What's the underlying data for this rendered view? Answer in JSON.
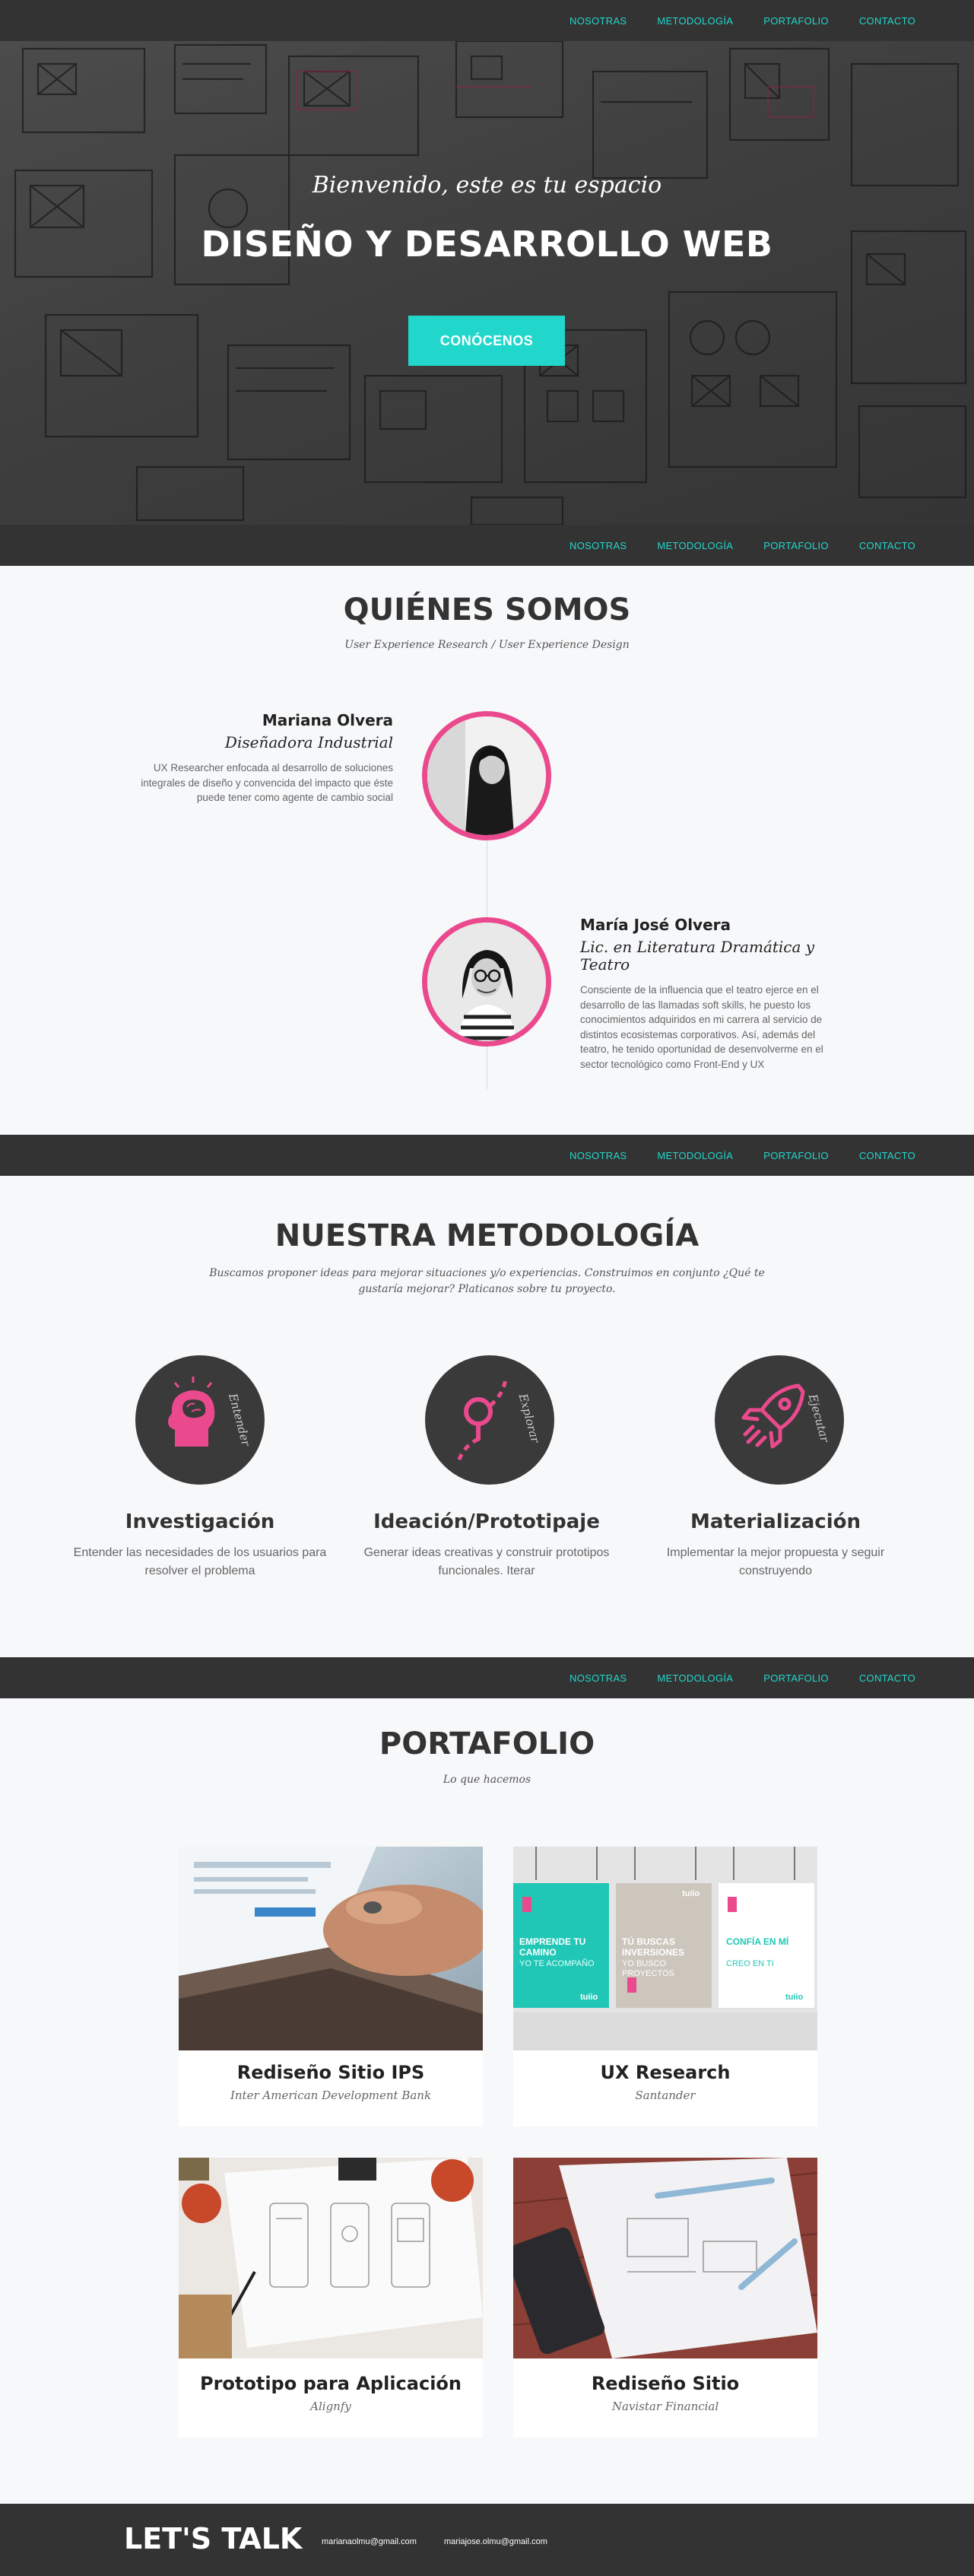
{
  "nav": {
    "items": [
      "NOSOTRAS",
      "METODOLOGÍA",
      "PORTAFOLIO",
      "CONTACTO"
    ]
  },
  "hero": {
    "subtitle": "Bienvenido, este es tu espacio",
    "title": "DISEÑO Y DESARROLLO WEB",
    "button": "CONÓCENOS"
  },
  "about": {
    "title": "QUIÉNES SOMOS",
    "subtitle": "User Experience Research / User Experience Design",
    "people": [
      {
        "name": "Mariana Olvera",
        "role": "Diseñadora Industrial",
        "description": "UX Researcher enfocada al desarrollo de soluciones integrales de diseño y convencida del impacto que éste puede tener como agente de cambio social"
      },
      {
        "name": "María José Olvera",
        "role": "Lic. en Literatura Dramática y Teatro",
        "description": "Consciente de la influencia que el teatro ejerce en el desarrollo de las llamadas soft skills, he puesto los conocimientos adquiridos en mi carrera al servicio de distintos ecosistemas corporativos. Así, además del teatro, he tenido oportunidad de desenvolverme en el sector tecnológico como Front-End y UX"
      }
    ]
  },
  "methodology": {
    "title": "NUESTRA METODOLOGÍA",
    "subtitle": "Buscamos proponer ideas para mejorar situaciones y/o experiencias. Construimos en conjunto ¿Qué te gustaría mejorar? Platicanos sobre tu proyecto.",
    "steps": [
      {
        "icon": "brain-head-icon",
        "badge": "Entender",
        "title": "Investigación",
        "description": "Entender las necesidades de los usuarios para resolver el problema"
      },
      {
        "icon": "magnifier-path-icon",
        "badge": "Explorar",
        "title": "Ideación/Prototipaje",
        "description": "Generar ideas creativas y construir prototipos funcionales. Iterar"
      },
      {
        "icon": "rocket-icon",
        "badge": "Ejecutar",
        "title": "Materialización",
        "description": "Implementar la mejor propuesta y seguir construyendo"
      }
    ]
  },
  "portfolio": {
    "title": "PORTAFOLIO",
    "subtitle": "Lo que hacemos",
    "projects": [
      {
        "title": "Rediseño Sitio IPS",
        "client": "Inter American Development Bank"
      },
      {
        "title": "UX Research",
        "client": "Santander",
        "posters": [
          {
            "head": "EMPRENDE TU CAMINO",
            "body": "YO TE ACOMPAÑO"
          },
          {
            "head": "TÚ BUSCAS INVERSIONES",
            "body": "YO BUSCO PROYECTOS"
          },
          {
            "head": "CONFÍA EN MÍ",
            "body": "CREO EN TI"
          }
        ],
        "brand": "tuiio"
      },
      {
        "title": "Prototipo para Aplicación",
        "client": "Alignfy"
      },
      {
        "title": "Rediseño Sitio",
        "client": "Navistar Financial"
      }
    ]
  },
  "footer": {
    "title": "LET'S TALK",
    "emails": [
      "marianaolmu@gmail.com",
      "mariajose.olmu@gmail.com"
    ]
  },
  "colors": {
    "accent": "#21d7cc",
    "pink": "#ea4a8d",
    "dark": "#333333"
  }
}
